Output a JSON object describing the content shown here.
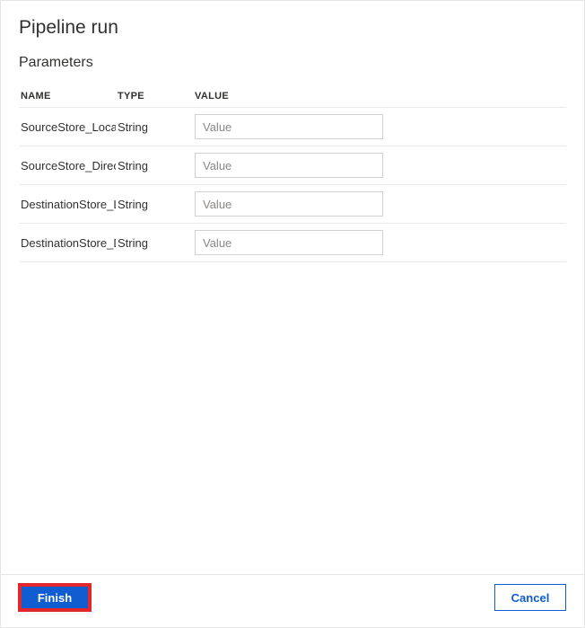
{
  "dialog": {
    "title": "Pipeline run"
  },
  "section": {
    "title": "Parameters"
  },
  "columns": {
    "name": "NAME",
    "type": "TYPE",
    "value": "VALUE"
  },
  "parameters": [
    {
      "name": "SourceStore_Location",
      "type": "String",
      "value": "",
      "placeholder": "Value"
    },
    {
      "name": "DestinationStore_Location",
      "type": "String",
      "value": "",
      "placeholder": "Value"
    }
  ],
  "rows": {
    "0": {
      "name": "SourceStore_Location",
      "type": "String",
      "placeholder": "Value"
    },
    "1": {
      "name": "SourceStore_Directory",
      "type": "String",
      "placeholder": "Value"
    },
    "2": {
      "name": "DestinationStore_Location",
      "type": "String",
      "placeholder": "Value"
    },
    "3": {
      "name": "DestinationStore_Directory",
      "type": "String",
      "placeholder": "Value"
    }
  },
  "footer": {
    "finish": "Finish",
    "cancel": "Cancel"
  }
}
